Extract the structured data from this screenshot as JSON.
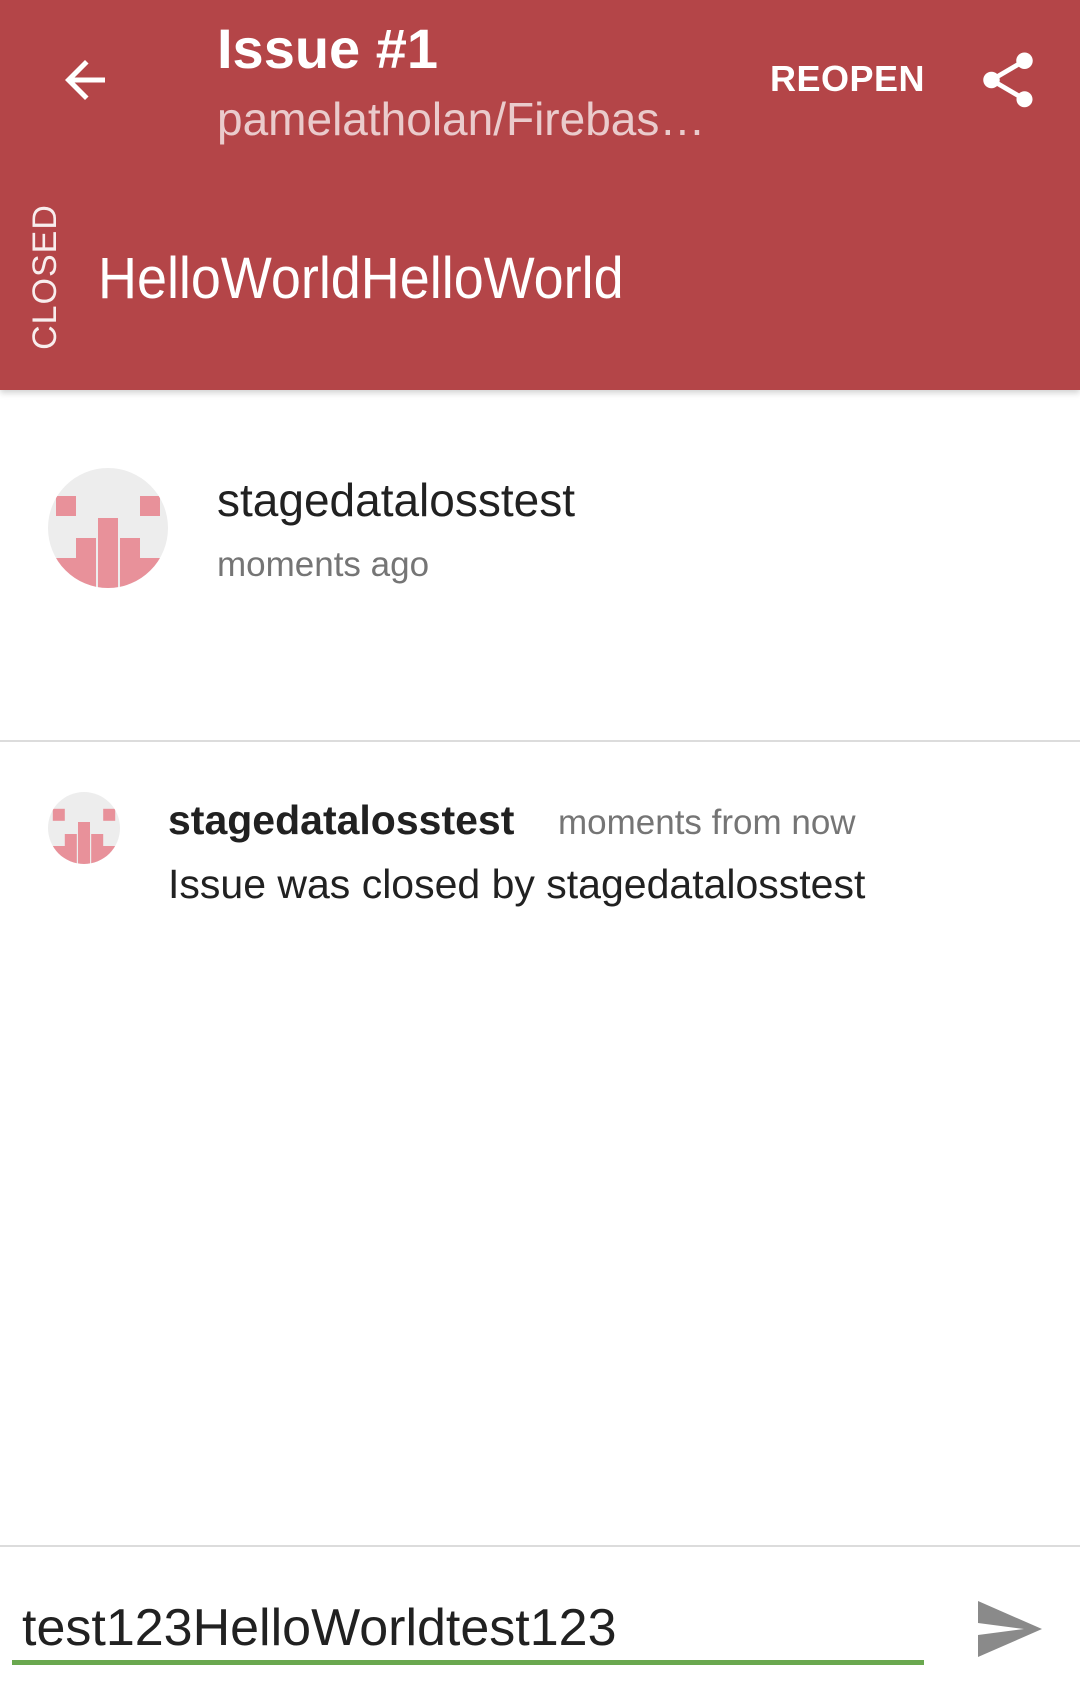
{
  "toolbar": {
    "back_icon": "arrow-back-icon",
    "title": "Issue #1",
    "subtitle": "pamelatholan/Firebase-Issue-Tracker",
    "reopen_label": "REOPEN",
    "share_icon": "share-icon",
    "background_color": "#b44548"
  },
  "issue": {
    "state": "CLOSED",
    "title": "HelloWorldHelloWorld",
    "author": "stagedatalosstest",
    "time": "moments ago"
  },
  "events": [
    {
      "user": "stagedatalosstest",
      "time": "moments from now",
      "text": "Issue was closed by stagedatalosstest"
    }
  ],
  "comment": {
    "value": "test123HelloWorldtest123",
    "send_icon": "send-icon",
    "accent_color": "#6aa84f"
  }
}
